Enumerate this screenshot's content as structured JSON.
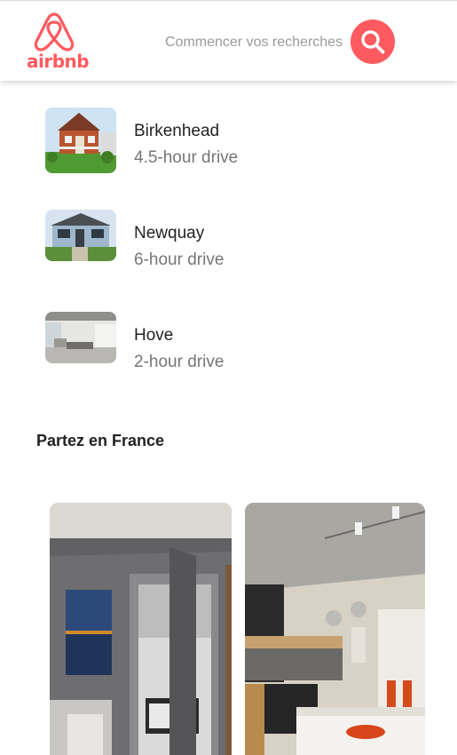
{
  "header": {
    "logo_text": "airbnb",
    "search_placeholder": "Commencer vos recherches",
    "search_icon": "search-icon"
  },
  "destinations": [
    {
      "name": "Birkenhead",
      "drive": "4.5-hour drive"
    },
    {
      "name": "Newquay",
      "drive": "6-hour drive"
    },
    {
      "name": "Hove",
      "drive": "2-hour drive"
    }
  ],
  "section": {
    "title": "Partez en France"
  },
  "colors": {
    "brand": "#ff5a5f",
    "text": "#222222",
    "muted": "#767676"
  }
}
